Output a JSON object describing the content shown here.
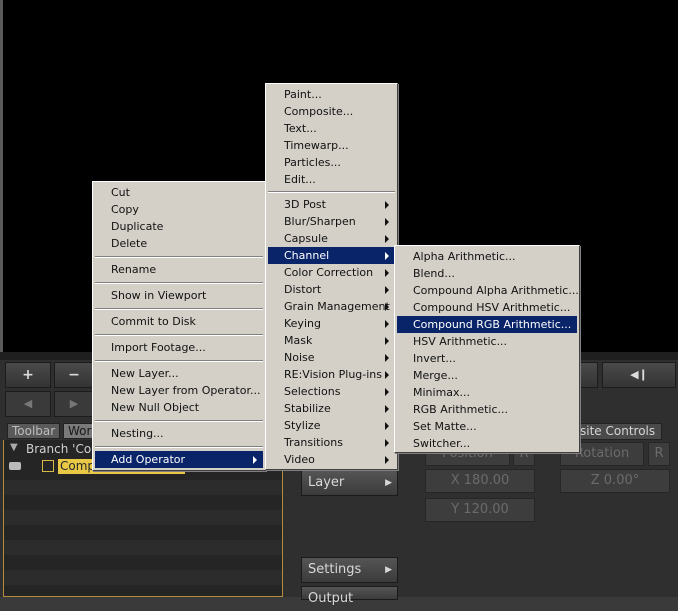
{
  "toolbar": {
    "plus": "+",
    "minus": "−",
    "back": "◀",
    "forward": "▶",
    "play_prev": "◀❙"
  },
  "tabs": {
    "toolbar": "Toolbar",
    "workspace": "Wor",
    "composite_controls": "site Controls"
  },
  "tree": {
    "branch_label": "Branch 'Co",
    "composite_label": "Composite - Untitled"
  },
  "sidebar_buttons": {
    "layer": "Layer",
    "settings": "Settings",
    "more": "Output"
  },
  "fields": {
    "position": "Position",
    "pos_btn": "R",
    "rotation": "Rotation",
    "rot_btn": "R",
    "x": "X 180.00",
    "z": "Z 0.00°",
    "y": "Y 120.00"
  },
  "context_menu": {
    "items": [
      "Cut",
      "Copy",
      "Duplicate",
      "Delete",
      "Rename",
      "Show in Viewport",
      "Commit to Disk",
      "Import Footage...",
      "New Layer...",
      "New Layer from Operator...",
      "New Null Object",
      "Nesting...",
      "Add Operator"
    ]
  },
  "operator_menu": {
    "top_items": [
      "Paint...",
      "Composite...",
      "Text...",
      "Timewarp...",
      "Particles...",
      "Edit..."
    ],
    "sub_items": [
      "3D Post",
      "Blur/Sharpen",
      "Capsule",
      "Channel",
      "Color Correction",
      "Distort",
      "Grain Management",
      "Keying",
      "Mask",
      "Noise",
      "RE:Vision Plug-ins",
      "Selections",
      "Stabilize",
      "Stylize",
      "Transitions",
      "Video"
    ]
  },
  "channel_menu": {
    "items": [
      "Alpha Arithmetic...",
      "Blend...",
      "Compound Alpha Arithmetic...",
      "Compound HSV Arithmetic...",
      "Compound RGB Arithmetic...",
      "HSV Arithmetic...",
      "Invert...",
      "Merge...",
      "Minimax...",
      "RGB Arithmetic...",
      "Set Matte...",
      "Switcher..."
    ]
  }
}
